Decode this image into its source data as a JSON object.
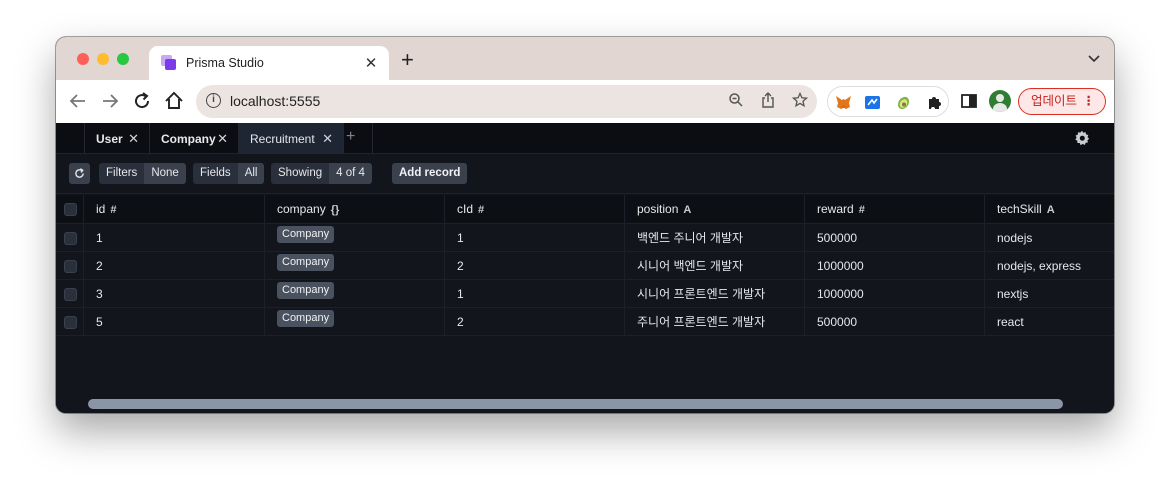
{
  "browser": {
    "tab_title": "Prisma Studio",
    "url": "localhost:5555",
    "update_label": "업데이트"
  },
  "prisma": {
    "model_tabs": [
      {
        "label": "User"
      },
      {
        "label": "Company"
      },
      {
        "label": "Recruitment",
        "active": true
      }
    ],
    "toolbar": {
      "filters_label": "Filters",
      "filters_value": "None",
      "fields_label": "Fields",
      "fields_value": "All",
      "showing_label": "Showing",
      "showing_value": "4 of 4",
      "add_record_label": "Add record"
    },
    "columns": [
      {
        "name": "id",
        "type_icon": "#"
      },
      {
        "name": "company",
        "type_icon": "{}"
      },
      {
        "name": "cId",
        "type_icon": "#"
      },
      {
        "name": "position",
        "type_icon": "A"
      },
      {
        "name": "reward",
        "type_icon": "#"
      },
      {
        "name": "techSkill",
        "type_icon": "A"
      }
    ],
    "rows": [
      {
        "id": "1",
        "company": "Company",
        "cId": "1",
        "position": "백엔드 주니어 개발자",
        "reward": "500000",
        "techSkill": "nodejs"
      },
      {
        "id": "2",
        "company": "Company",
        "cId": "2",
        "position": "시니어 백엔드 개발자",
        "reward": "1000000",
        "techSkill": "nodejs, express"
      },
      {
        "id": "3",
        "company": "Company",
        "cId": "1",
        "position": "시니어 프론트엔드 개발자",
        "reward": "1000000",
        "techSkill": "nextjs"
      },
      {
        "id": "5",
        "company": "Company",
        "cId": "2",
        "position": "주니어 프론트엔드 개발자",
        "reward": "500000",
        "techSkill": "react"
      }
    ]
  },
  "colors": {
    "app_background": "#12151c",
    "active_tab": "#1e2633",
    "update_accent": "#d93025"
  }
}
